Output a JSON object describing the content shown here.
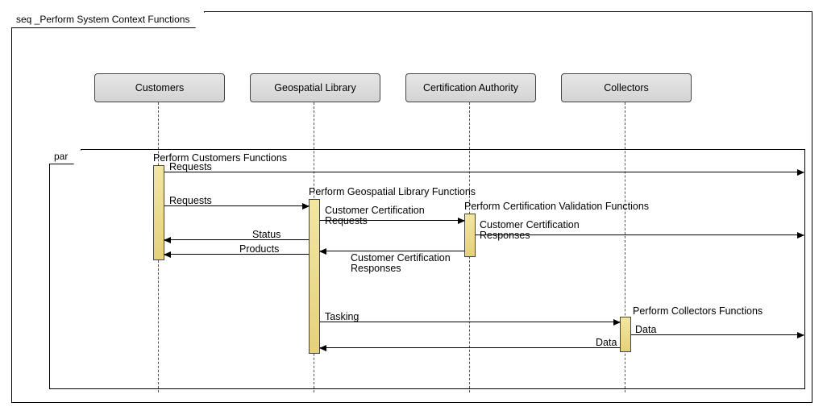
{
  "frame": {
    "outer_title": "seq _Perform System Context Functions",
    "inner_title": "par"
  },
  "participants": {
    "p1": "Customers",
    "p2": "Geospatial Library",
    "p3": "Certification Authority",
    "p4": "Collectors"
  },
  "activations": {
    "a1": "Perform Customers Functions",
    "a2": "Perform Geospatial Library Functions",
    "a3": "Perform Certification Validation Functions",
    "a4": "Perform Collectors Functions"
  },
  "messages": {
    "m1": "Requests",
    "m2": "Requests",
    "m3": "Customer Certification",
    "m3b": "Requests",
    "m4": "Customer Certification",
    "m4b": "Responses",
    "m5": "Status",
    "m6": "Products",
    "m7": "Customer Certification",
    "m7b": "Responses",
    "m8": "Tasking",
    "m9": "Data",
    "m10": "Data"
  }
}
